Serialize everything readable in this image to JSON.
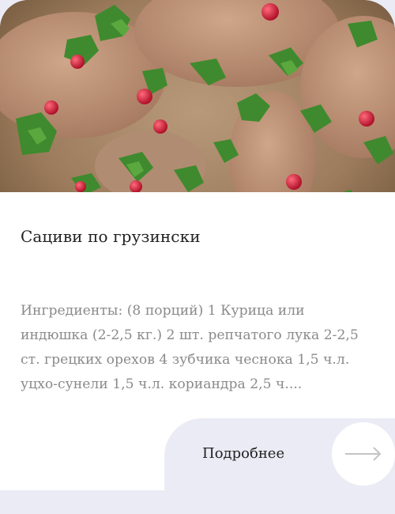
{
  "card": {
    "title": "Сациви по грузински",
    "description": "Ингредиенты: (8 порций) 1 Курица или индюшка (2-2,5 кг.) 2 шт. репчатого лука 2-2,5 ст. грецких орехов 4 зубчика чеснока 1,5 ч.л. уцхо-сунели 1,5 ч.л. кориандра 2,5 ч....",
    "more_label": "Подробнее",
    "arrow_icon": "arrow-right-icon"
  },
  "colors": {
    "page_bg": "#ebebf5",
    "card_bg": "#ffffff",
    "title": "#222222",
    "description": "#8a8a8a",
    "arrow": "#c4c4c4"
  }
}
